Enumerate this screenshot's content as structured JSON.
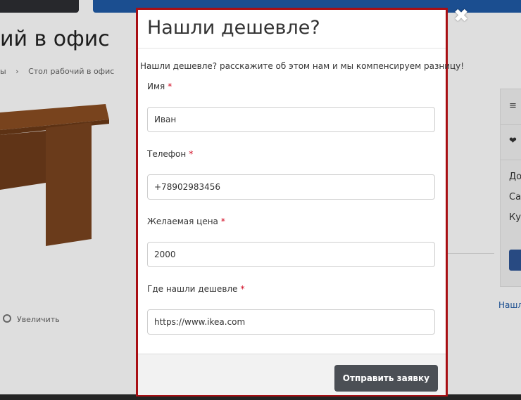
{
  "background": {
    "page_title": "ий в офис",
    "breadcrumbs": [
      "ы",
      "Стол рабочий в офис"
    ],
    "zoom_label": "Увеличить",
    "right_panel": {
      "menu_icon": "≡",
      "favorite_icon": "❤",
      "items": [
        "До",
        "Са",
        "Кур"
      ]
    },
    "side_link": "Нашл"
  },
  "modal": {
    "title": "Нашли дешевле?",
    "intro": "Нашли дешевле? расскажите об этом нам и мы компенсируем разницу!",
    "required_mark": "*",
    "fields": [
      {
        "label": "Имя",
        "value": "Иван"
      },
      {
        "label": "Телефон",
        "value": "+78902983456"
      },
      {
        "label": "Желаемая цена",
        "value": "2000"
      },
      {
        "label": "Где нашли дешевле",
        "value": "https://www.ikea.com"
      }
    ],
    "submit_label": "Отправить заявку",
    "close_icon": "✖"
  }
}
